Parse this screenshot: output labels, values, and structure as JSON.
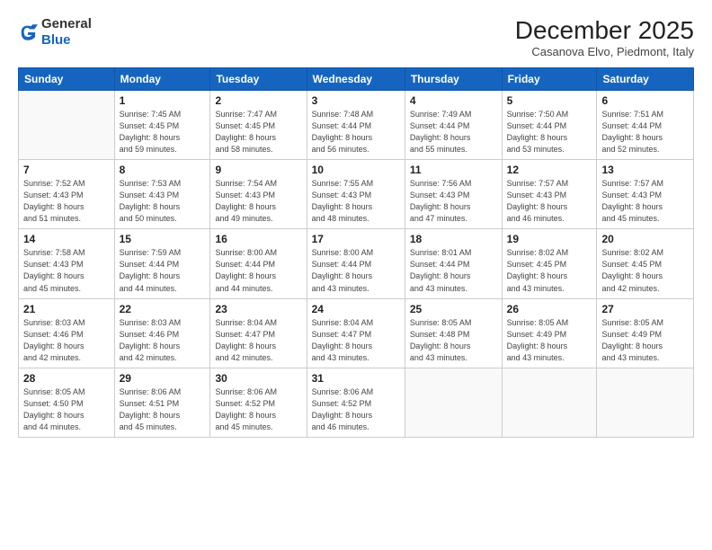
{
  "header": {
    "logo_line1": "General",
    "logo_line2": "Blue",
    "month": "December 2025",
    "location": "Casanova Elvo, Piedmont, Italy"
  },
  "days_of_week": [
    "Sunday",
    "Monday",
    "Tuesday",
    "Wednesday",
    "Thursday",
    "Friday",
    "Saturday"
  ],
  "weeks": [
    [
      {
        "day": "",
        "info": ""
      },
      {
        "day": "1",
        "info": "Sunrise: 7:45 AM\nSunset: 4:45 PM\nDaylight: 8 hours\nand 59 minutes."
      },
      {
        "day": "2",
        "info": "Sunrise: 7:47 AM\nSunset: 4:45 PM\nDaylight: 8 hours\nand 58 minutes."
      },
      {
        "day": "3",
        "info": "Sunrise: 7:48 AM\nSunset: 4:44 PM\nDaylight: 8 hours\nand 56 minutes."
      },
      {
        "day": "4",
        "info": "Sunrise: 7:49 AM\nSunset: 4:44 PM\nDaylight: 8 hours\nand 55 minutes."
      },
      {
        "day": "5",
        "info": "Sunrise: 7:50 AM\nSunset: 4:44 PM\nDaylight: 8 hours\nand 53 minutes."
      },
      {
        "day": "6",
        "info": "Sunrise: 7:51 AM\nSunset: 4:44 PM\nDaylight: 8 hours\nand 52 minutes."
      }
    ],
    [
      {
        "day": "7",
        "info": "Sunrise: 7:52 AM\nSunset: 4:43 PM\nDaylight: 8 hours\nand 51 minutes."
      },
      {
        "day": "8",
        "info": "Sunrise: 7:53 AM\nSunset: 4:43 PM\nDaylight: 8 hours\nand 50 minutes."
      },
      {
        "day": "9",
        "info": "Sunrise: 7:54 AM\nSunset: 4:43 PM\nDaylight: 8 hours\nand 49 minutes."
      },
      {
        "day": "10",
        "info": "Sunrise: 7:55 AM\nSunset: 4:43 PM\nDaylight: 8 hours\nand 48 minutes."
      },
      {
        "day": "11",
        "info": "Sunrise: 7:56 AM\nSunset: 4:43 PM\nDaylight: 8 hours\nand 47 minutes."
      },
      {
        "day": "12",
        "info": "Sunrise: 7:57 AM\nSunset: 4:43 PM\nDaylight: 8 hours\nand 46 minutes."
      },
      {
        "day": "13",
        "info": "Sunrise: 7:57 AM\nSunset: 4:43 PM\nDaylight: 8 hours\nand 45 minutes."
      }
    ],
    [
      {
        "day": "14",
        "info": "Sunrise: 7:58 AM\nSunset: 4:43 PM\nDaylight: 8 hours\nand 45 minutes."
      },
      {
        "day": "15",
        "info": "Sunrise: 7:59 AM\nSunset: 4:44 PM\nDaylight: 8 hours\nand 44 minutes."
      },
      {
        "day": "16",
        "info": "Sunrise: 8:00 AM\nSunset: 4:44 PM\nDaylight: 8 hours\nand 44 minutes."
      },
      {
        "day": "17",
        "info": "Sunrise: 8:00 AM\nSunset: 4:44 PM\nDaylight: 8 hours\nand 43 minutes."
      },
      {
        "day": "18",
        "info": "Sunrise: 8:01 AM\nSunset: 4:44 PM\nDaylight: 8 hours\nand 43 minutes."
      },
      {
        "day": "19",
        "info": "Sunrise: 8:02 AM\nSunset: 4:45 PM\nDaylight: 8 hours\nand 43 minutes."
      },
      {
        "day": "20",
        "info": "Sunrise: 8:02 AM\nSunset: 4:45 PM\nDaylight: 8 hours\nand 42 minutes."
      }
    ],
    [
      {
        "day": "21",
        "info": "Sunrise: 8:03 AM\nSunset: 4:46 PM\nDaylight: 8 hours\nand 42 minutes."
      },
      {
        "day": "22",
        "info": "Sunrise: 8:03 AM\nSunset: 4:46 PM\nDaylight: 8 hours\nand 42 minutes."
      },
      {
        "day": "23",
        "info": "Sunrise: 8:04 AM\nSunset: 4:47 PM\nDaylight: 8 hours\nand 42 minutes."
      },
      {
        "day": "24",
        "info": "Sunrise: 8:04 AM\nSunset: 4:47 PM\nDaylight: 8 hours\nand 43 minutes."
      },
      {
        "day": "25",
        "info": "Sunrise: 8:05 AM\nSunset: 4:48 PM\nDaylight: 8 hours\nand 43 minutes."
      },
      {
        "day": "26",
        "info": "Sunrise: 8:05 AM\nSunset: 4:49 PM\nDaylight: 8 hours\nand 43 minutes."
      },
      {
        "day": "27",
        "info": "Sunrise: 8:05 AM\nSunset: 4:49 PM\nDaylight: 8 hours\nand 43 minutes."
      }
    ],
    [
      {
        "day": "28",
        "info": "Sunrise: 8:05 AM\nSunset: 4:50 PM\nDaylight: 8 hours\nand 44 minutes."
      },
      {
        "day": "29",
        "info": "Sunrise: 8:06 AM\nSunset: 4:51 PM\nDaylight: 8 hours\nand 45 minutes."
      },
      {
        "day": "30",
        "info": "Sunrise: 8:06 AM\nSunset: 4:52 PM\nDaylight: 8 hours\nand 45 minutes."
      },
      {
        "day": "31",
        "info": "Sunrise: 8:06 AM\nSunset: 4:52 PM\nDaylight: 8 hours\nand 46 minutes."
      },
      {
        "day": "",
        "info": ""
      },
      {
        "day": "",
        "info": ""
      },
      {
        "day": "",
        "info": ""
      }
    ]
  ]
}
